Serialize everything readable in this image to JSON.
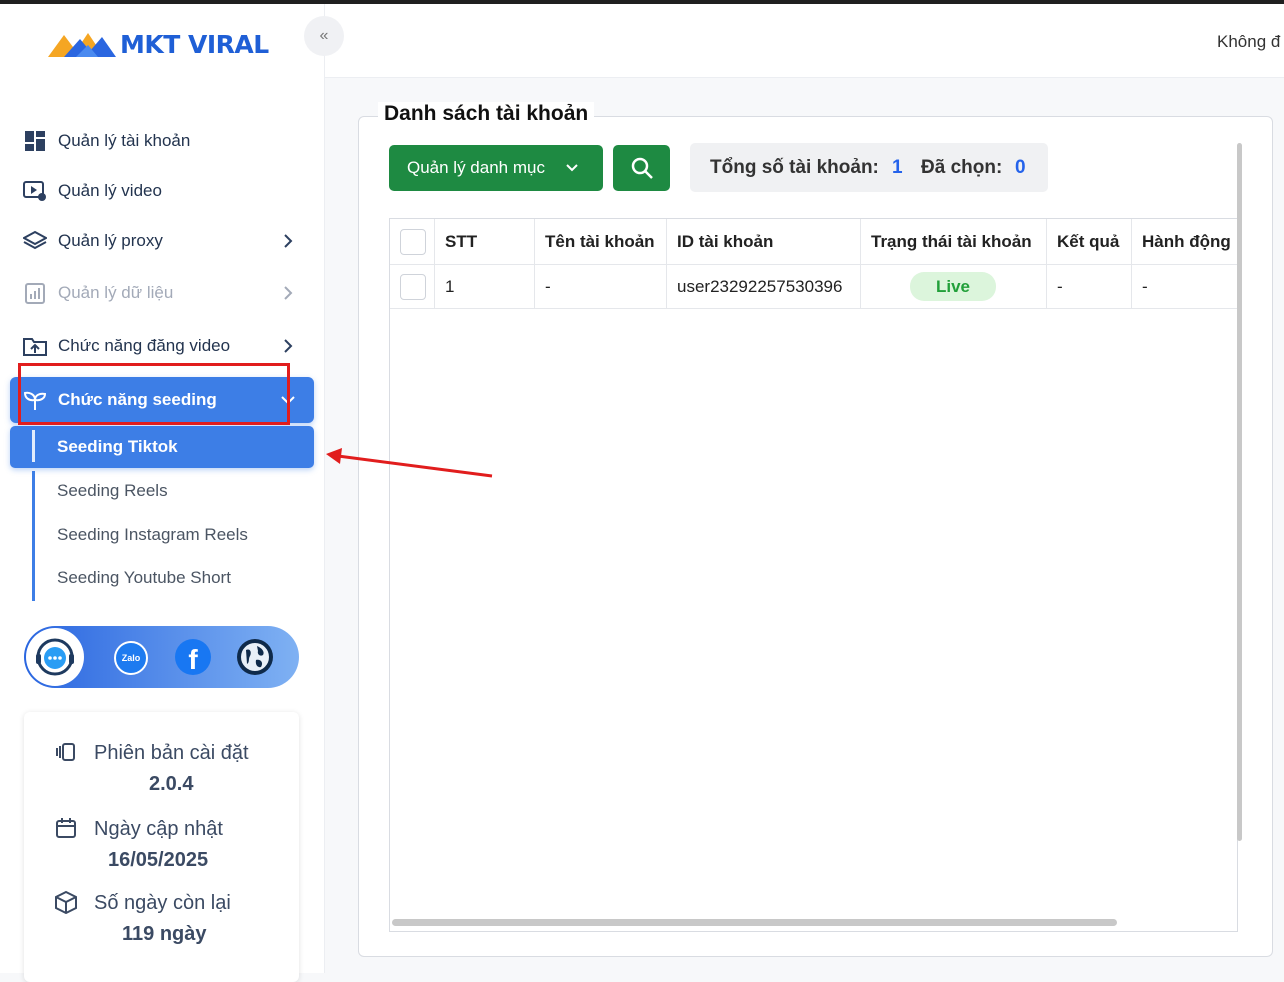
{
  "app": {
    "logo_text": "MKT VIRAL",
    "collapse_glyph": "«"
  },
  "topbar": {
    "user_text": "Không đ"
  },
  "sidebar": {
    "menu": [
      {
        "label": "Quản lý tài khoản",
        "icon": "dashboard-icon",
        "has_chevron": false
      },
      {
        "label": "Quản lý video",
        "icon": "video-settings-icon",
        "has_chevron": false
      },
      {
        "label": "Quản lý proxy",
        "icon": "layers-icon",
        "has_chevron": true
      },
      {
        "label": "Quản lý dữ liệu",
        "icon": "data-chart-icon",
        "has_chevron": true,
        "disabled": true
      },
      {
        "label": "Chức năng đăng video",
        "icon": "folder-upload-icon",
        "has_chevron": true
      },
      {
        "label": "Chức năng seeding",
        "icon": "seedling-icon",
        "has_chevron": true,
        "active": true
      }
    ],
    "submenu": [
      {
        "label": "Seeding Tiktok",
        "active": true
      },
      {
        "label": "Seeding Reels"
      },
      {
        "label": "Seeding Instagram Reels"
      },
      {
        "label": "Seeding Youtube Short"
      }
    ],
    "social": [
      {
        "name": "support-chat-icon",
        "color": "#ffffff"
      },
      {
        "name": "zalo-icon",
        "text": "Zalo",
        "color": "#1e7bf0"
      },
      {
        "name": "facebook-icon",
        "text": "f",
        "color": "#1877f2"
      },
      {
        "name": "globe-icon",
        "color": "#0f2a4a"
      }
    ],
    "info": {
      "version_label": "Phiên bản cài đặt",
      "version_value": "2.0.4",
      "updated_label": "Ngày cập nhật",
      "updated_value": "16/05/2025",
      "remaining_label": "Số ngày còn lại",
      "remaining_value": "119 ngày"
    }
  },
  "main": {
    "panel_title": "Danh sách tài khoản",
    "category_button": "Quản lý danh mục",
    "stats": {
      "total_label": "Tổng số tài khoản:",
      "total_value": "1",
      "selected_label": "Đã chọn:",
      "selected_value": "0"
    },
    "table": {
      "columns": [
        "STT",
        "Tên tài khoản",
        "ID tài khoản",
        "Trạng thái tài khoản",
        "Kết quả",
        "Hành động"
      ],
      "rows": [
        {
          "stt": "1",
          "name": "-",
          "id": "user23292257530396",
          "status": "Live",
          "result": "-",
          "action": "-"
        }
      ]
    }
  },
  "colors": {
    "accent": "#3d7ee6",
    "green": "#1e8a42",
    "live_bg": "#dcf5dc",
    "live_text": "#22a03a",
    "annotation": "#e11d1d"
  }
}
